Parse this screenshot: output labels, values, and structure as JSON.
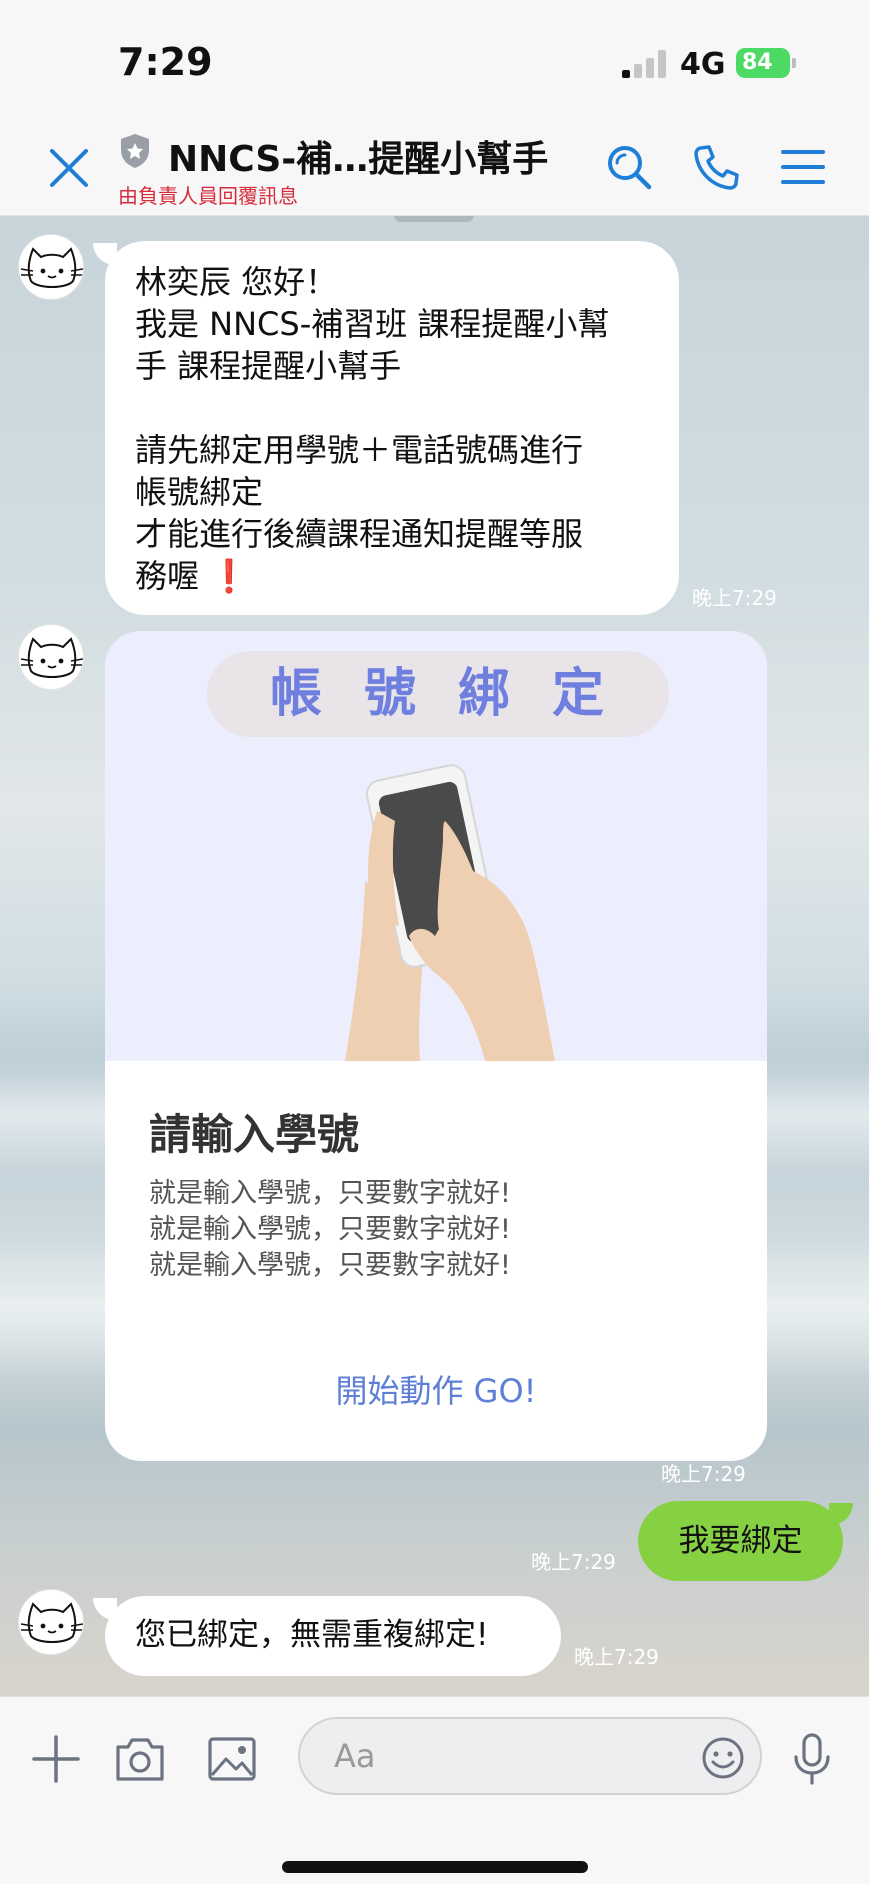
{
  "status": {
    "time": "7:29",
    "network": "4G",
    "battery": "84"
  },
  "header": {
    "title": "NNCS-補…提醒小幫手",
    "subtitle": "由負責人員回覆訊息"
  },
  "messages": {
    "greeting": {
      "lines": [
        "林奕辰 您好！",
        "我是 NNCS-補習班 課程提醒小幫",
        "手 課程提醒小幫手",
        "",
        "請先綁定用學號＋電話號碼進行",
        "帳號綁定",
        "才能進行後續課程通知提醒等服",
        "務喔"
      ],
      "emoji": "❗",
      "time": "晚上7:29"
    },
    "card": {
      "banner": "帳號綁定",
      "title": "請輸入學號",
      "desc": [
        "就是輸入學號，只要數字就好!",
        "就是輸入學號，只要數字就好!",
        "就是輸入學號，只要數字就好!"
      ],
      "action": "開始動作 GO!",
      "time": "晚上7:29"
    },
    "mine": {
      "text": "我要綁定",
      "time": "晚上7:29"
    },
    "reply": {
      "text": "您已綁定，無需重複綁定!",
      "time": "晚上7:29"
    }
  },
  "input": {
    "placeholder": "Aa"
  },
  "colors": {
    "accent": "#1f7fd8",
    "mine_bubble": "#86d142",
    "subtitle": "#d62c3c",
    "action_link": "#5e7fd6"
  }
}
